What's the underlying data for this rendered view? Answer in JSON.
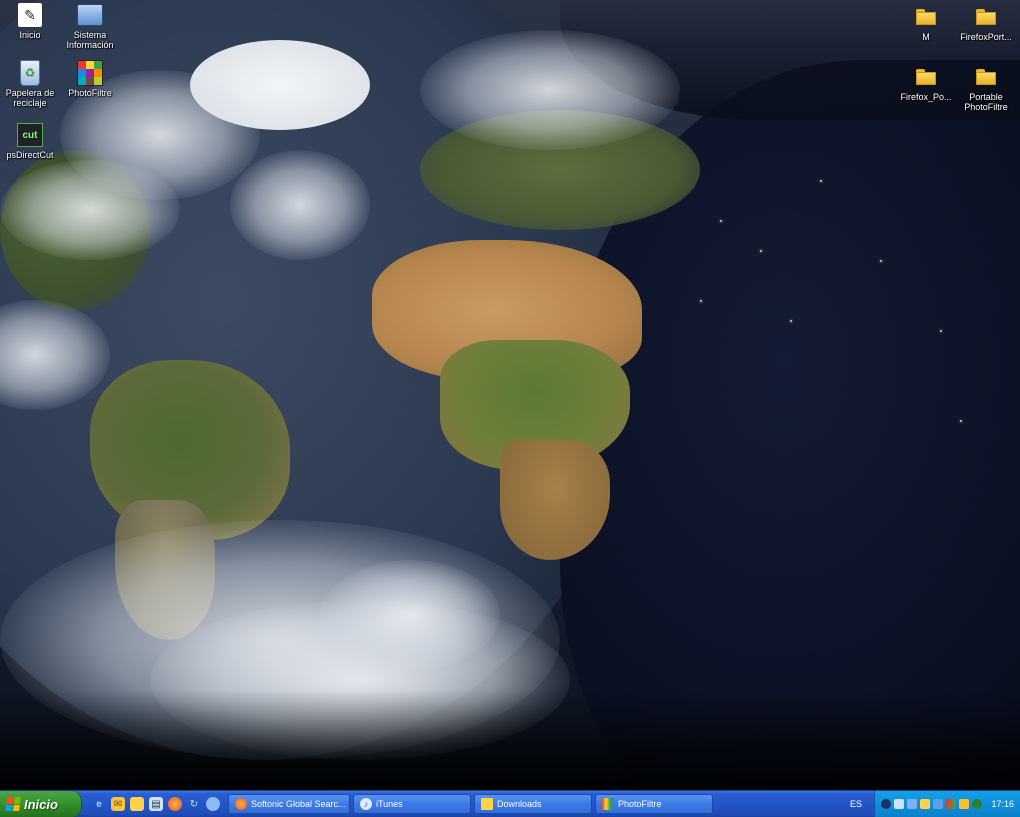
{
  "desktop": {
    "icons_left": [
      {
        "id": "inicio",
        "label": "Inicio",
        "icon": "app-icon"
      },
      {
        "id": "system",
        "label": "Sistema\nInformación",
        "icon": "system-info-icon"
      },
      {
        "id": "recycle",
        "label": "Papelera de\nreciclaje",
        "icon": "recycle-bin-icon"
      },
      {
        "id": "photofiltre",
        "label": "PhotoFiltre",
        "icon": "photofiltre-icon"
      },
      {
        "id": "psdirect",
        "label": "psDirectCut",
        "icon": "cut-app-icon"
      }
    ],
    "icons_right": [
      {
        "id": "m",
        "label": "M",
        "icon": "folder-icon"
      },
      {
        "id": "firefoxport",
        "label": "FirefoxPort...",
        "icon": "folder-icon"
      },
      {
        "id": "firefox_po",
        "label": "Firefox_Po...",
        "icon": "folder-icon"
      },
      {
        "id": "portable_photofiltre",
        "label": "Portable\nPhotoFiltre",
        "icon": "folder-icon"
      }
    ]
  },
  "taskbar": {
    "start_label": "Inicio",
    "quick_launch": [
      "ie-icon",
      "outlook-icon",
      "folder-icon",
      "explorer-icon",
      "firefox-icon",
      "ie-refresh-icon",
      "network-icon"
    ],
    "tasks": [
      {
        "label": "Softonic Global Searc...",
        "icon": "firefox-icon"
      },
      {
        "label": "iTunes",
        "icon": "itunes-icon"
      },
      {
        "label": "Downloads",
        "icon": "folder-icon"
      },
      {
        "label": "PhotoFiltre",
        "icon": "photofiltre-icon"
      }
    ],
    "language": "ES",
    "tray_icons": [
      "security-icon",
      "network-icon",
      "update-icon",
      "calendar-icon",
      "app-tray-icon",
      "antivirus-icon",
      "volume-icon",
      "messenger-icon"
    ],
    "clock": "17:16"
  },
  "colors": {
    "taskbar_blue": "#2456c9",
    "start_green": "#38962f",
    "tray_blue": "#0f8fda",
    "folder_yellow": "#ffdf6b"
  }
}
